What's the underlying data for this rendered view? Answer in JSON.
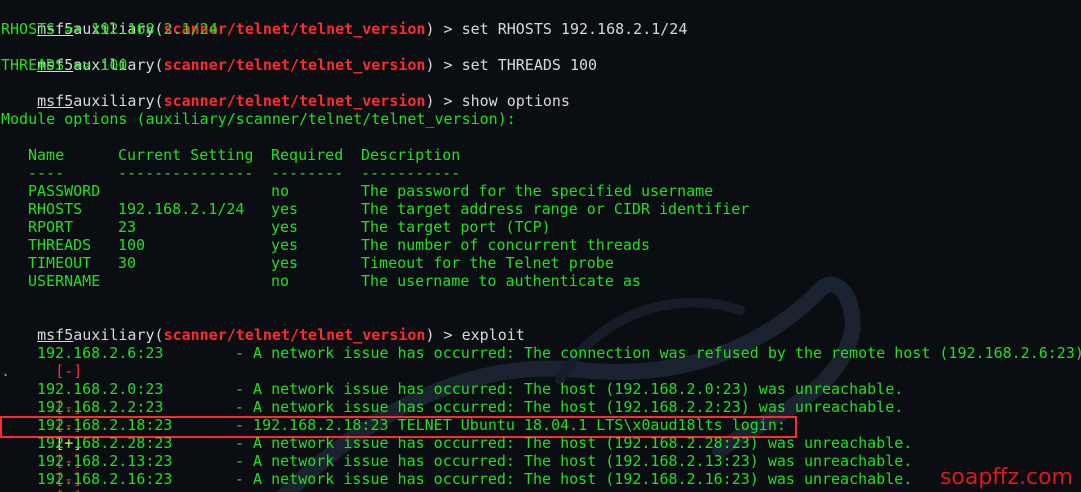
{
  "prompt": {
    "name": "msf5",
    "mod_prefix": "auxiliary(",
    "mod_path": "scanner/telnet/telnet_version",
    "mod_suffix": ") > "
  },
  "commands": {
    "set_rhosts": "set RHOSTS 192.168.2.1/24",
    "rhosts_out": "RHOSTS => 192.168.2.1/24",
    "set_threads": "set THREADS 100",
    "threads_out": "THREADS => 100",
    "show_options": "show options",
    "exploit": "exploit"
  },
  "module_options_header": "Module options (auxiliary/scanner/telnet/telnet_version):",
  "options_table": {
    "headers": [
      "Name",
      "Current Setting",
      "Required",
      "Description"
    ],
    "separators": [
      "----",
      "---------------",
      "--------",
      "-----------"
    ],
    "rows": [
      {
        "name": "PASSWORD",
        "setting": "",
        "required": "no",
        "description": "The password for the specified username"
      },
      {
        "name": "RHOSTS",
        "setting": "192.168.2.1/24",
        "required": "yes",
        "description": "The target address range or CIDR identifier"
      },
      {
        "name": "RPORT",
        "setting": "23",
        "required": "yes",
        "description": "The target port (TCP)"
      },
      {
        "name": "THREADS",
        "setting": "100",
        "required": "yes",
        "description": "The number of concurrent threads"
      },
      {
        "name": "TIMEOUT",
        "setting": "30",
        "required": "yes",
        "description": "Timeout for the Telnet probe"
      },
      {
        "name": "USERNAME",
        "setting": "",
        "required": "no",
        "description": "The username to authenticate as"
      }
    ]
  },
  "results": [
    {
      "tag": "[-]",
      "host": "192.168.2.6:23",
      "msg": "- A network issue has occurred: The connection was refused by the remote host (192.168.2.6:23)"
    },
    {
      "tag": "",
      "host": "",
      "msg": "."
    },
    {
      "tag": "[-]",
      "host": "192.168.2.0:23",
      "msg": "- A network issue has occurred: The host (192.168.2.0:23) was unreachable."
    },
    {
      "tag": "[-]",
      "host": "192.168.2.2:23",
      "msg": "- A network issue has occurred: The host (192.168.2.2:23) was unreachable."
    },
    {
      "tag": "[+]",
      "host": "192.168.2.18:23",
      "msg": "- 192.168.2.18:23 TELNET Ubuntu 18.04.1 LTS\\x0aud18lts login:"
    },
    {
      "tag": "[-]",
      "host": "192.168.2.28:23",
      "msg": "- A network issue has occurred: The host (192.168.2.28:23) was unreachable."
    },
    {
      "tag": "[-]",
      "host": "192.168.2.13:23",
      "msg": "- A network issue has occurred: The host (192.168.2.13:23) was unreachable."
    },
    {
      "tag": "[-]",
      "host": "192.168.2.16:23",
      "msg": "- A network issue has occurred: The host (192.168.2.16:23) was unreachable."
    }
  ],
  "watermark": "soapffz.com",
  "colors": {
    "background": "#0a0d12",
    "text_green": "#1ee21e",
    "module_red": "#ff2a2a",
    "success_yellow": "#e8e84a",
    "highlight_border": "#ff2a2a"
  }
}
